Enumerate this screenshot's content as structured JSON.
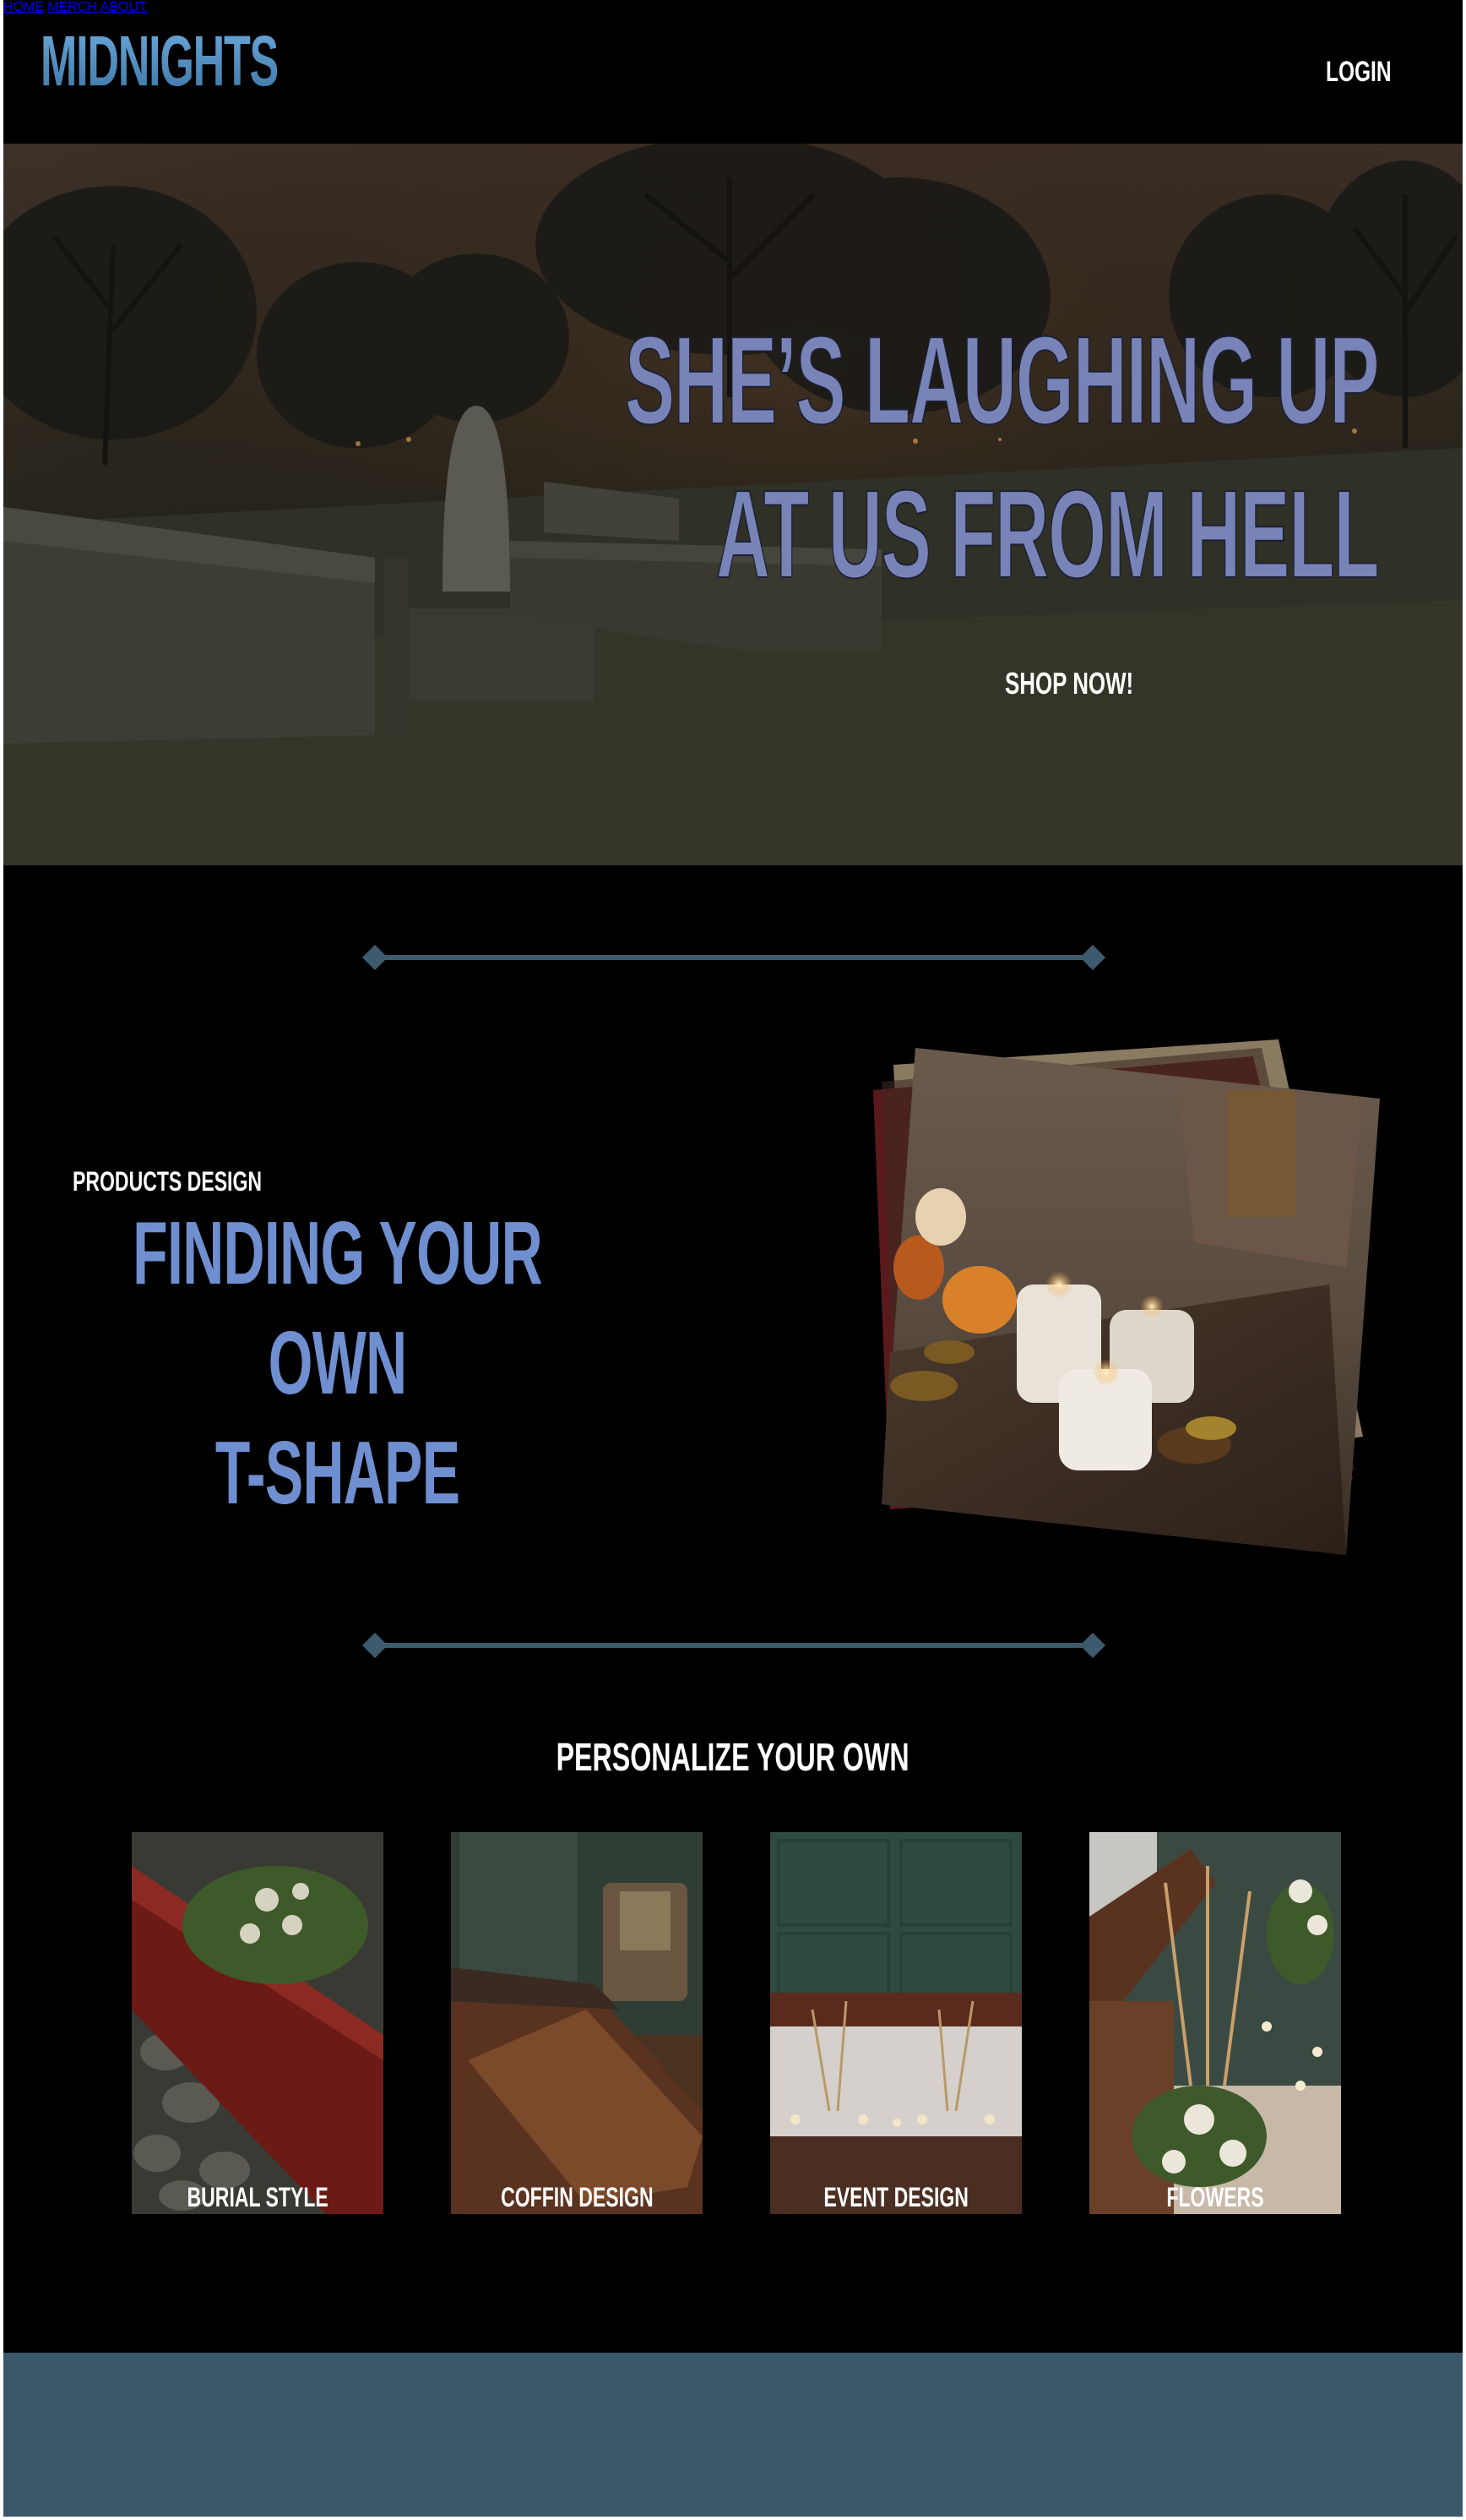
{
  "header": {
    "logo": "MIDNIGHTS",
    "nav": [
      {
        "label": "HOME"
      },
      {
        "label": "MERCH"
      },
      {
        "label": "ABOUT"
      }
    ],
    "login": "LOGIN"
  },
  "hero": {
    "title_line1": "SHE’S LAUGHING UP",
    "title_line2": "AT US FROM HELL",
    "cta": "SHOP NOW!"
  },
  "feature": {
    "eyebrow": "PRODUCTS DESIGN",
    "title_line1": "FINDING YOUR OWN",
    "title_line2": "T-SHAPE"
  },
  "personalize": {
    "title": "PERSONALIZE YOUR OWN",
    "cards": [
      {
        "label": "BURIAL STYLE"
      },
      {
        "label": "COFFIN DESIGN"
      },
      {
        "label": "EVENT DESIGN"
      },
      {
        "label": "FLOWERS"
      }
    ]
  },
  "colors": {
    "accent_blue": "#6f8fd0",
    "hero_title": "#7883b7",
    "divider": "#3e5a6e",
    "footer": "#3b576a"
  }
}
